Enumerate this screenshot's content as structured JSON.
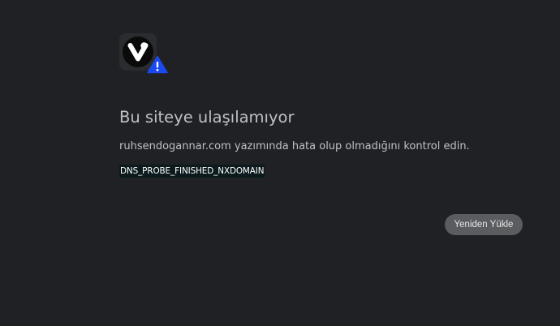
{
  "icons": {
    "browser_logo": "vivaldi-logo-icon",
    "warning": "warning-triangle-icon"
  },
  "colors": {
    "background": "#202124",
    "text": "#bdc1c6",
    "warning_badge": "#1a49f0",
    "button": "#5b5c60"
  },
  "error": {
    "headline": "Bu siteye ulaşılamıyor",
    "message": "ruhsendogannar.com yazımında hata olup olmadığını kontrol edin.",
    "code": "DNS_PROBE_FINISHED_NXDOMAIN"
  },
  "actions": {
    "reload_label": "Yeniden Yükle"
  }
}
